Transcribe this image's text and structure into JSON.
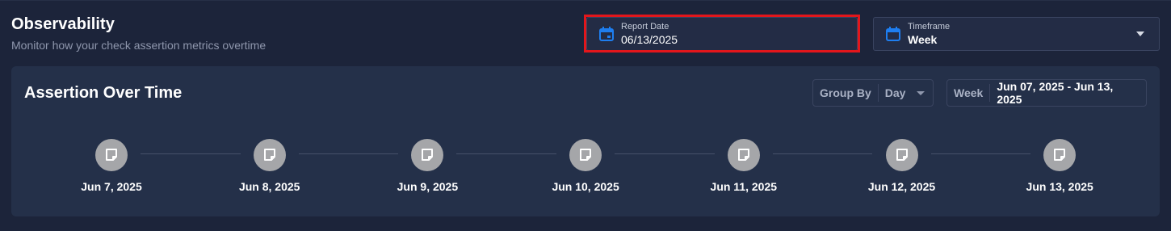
{
  "header": {
    "title": "Observability",
    "subtitle": "Monitor how your check assertion metrics overtime"
  },
  "report_date": {
    "label": "Report Date",
    "value": "06/13/2025",
    "icon": "calendar-icon"
  },
  "timeframe": {
    "label": "Timeframe",
    "value": "Week",
    "icon": "calendar-icon"
  },
  "card": {
    "title": "Assertion Over Time",
    "group_by": {
      "label": "Group By",
      "value": "Day"
    },
    "week": {
      "label": "Week",
      "value": "Jun 07, 2025 - Jun 13, 2025"
    }
  },
  "timeline": {
    "icon": "note-icon",
    "dates": [
      "Jun 7, 2025",
      "Jun 8, 2025",
      "Jun 9, 2025",
      "Jun 10, 2025",
      "Jun 11, 2025",
      "Jun 12, 2025",
      "Jun 13, 2025"
    ]
  },
  "colors": {
    "accent": "#1e7ef0",
    "highlight": "#e3161b",
    "node": "#a5a6a9"
  }
}
